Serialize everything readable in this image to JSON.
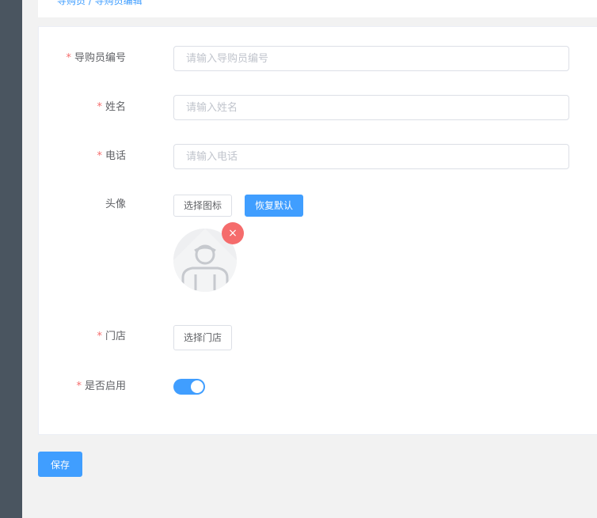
{
  "breadcrumb": {
    "partial": "导购员 / 导购员编辑"
  },
  "form": {
    "guide_no": {
      "label": "导购员编号",
      "required": "*",
      "placeholder": "请输入导购员编号",
      "value": ""
    },
    "name": {
      "label": "姓名",
      "required": "*",
      "placeholder": "请输入姓名",
      "value": ""
    },
    "phone": {
      "label": "电话",
      "required": "*",
      "placeholder": "请输入电话",
      "value": ""
    },
    "avatar": {
      "label": "头像",
      "choose_label": "选择图标",
      "reset_label": "恢复默认",
      "remove_icon": "close-icon",
      "remove_glyph": "×",
      "image_icon": "default-user-avatar"
    },
    "store": {
      "label": "门店",
      "required": "*",
      "choose_label": "选择门店"
    },
    "enabled": {
      "label": "是否启用",
      "required": "*",
      "value": true
    }
  },
  "actions": {
    "save_label": "保存"
  },
  "colors": {
    "primary": "#409eff",
    "danger": "#f56c6c",
    "sidebar": "#4a5560",
    "page_bg": "#f2f2f2"
  }
}
